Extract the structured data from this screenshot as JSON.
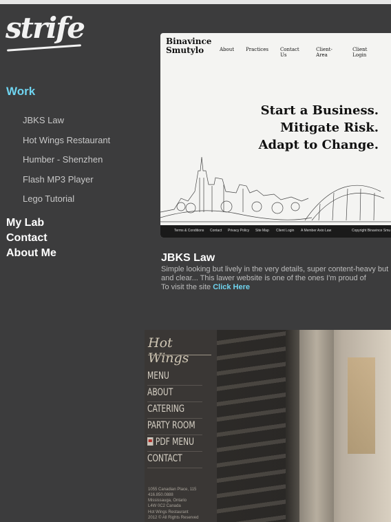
{
  "logo": {
    "text": "strife"
  },
  "sidebar": {
    "work_label": "Work",
    "work_items": [
      "JBKS Law",
      "Hot Wings Restaurant",
      "Humber - Shenzhen",
      "Flash MP3 Player",
      "Lego Tutorial"
    ],
    "main_items": [
      "My Lab",
      "Contact",
      "About Me"
    ]
  },
  "project1": {
    "screenshot": {
      "brand_line1": "Binavince",
      "brand_line2": "Smutylo",
      "nav": [
        "About",
        "Practices",
        "Contact Us",
        "Client-Area",
        "Client Login"
      ],
      "headline": [
        "Start a Business.",
        "Mitigate Risk.",
        "Adapt to Change."
      ],
      "footer": [
        "Terms & Conditions",
        "Contact",
        "Privacy Policy",
        "Site Map",
        "Client Login",
        "A Member Axio Law",
        "Copyright Binavince Smu"
      ]
    },
    "title": "JBKS Law",
    "description": "Simple looking but lively in the very details, super content-heavy but and clear... This lawer website is one of the ones I'm proud of",
    "visit_prefix": "To visit the site",
    "visit_link": "Click Here"
  },
  "project2": {
    "screenshot": {
      "logo": "Hot Wings",
      "menu": [
        "MENU",
        "ABOUT",
        "CATERING",
        "PARTY ROOM",
        "PDF MENU",
        "CONTACT"
      ],
      "address": [
        "1055 Canadian Place, 115",
        "416.850.0888",
        "Mississauga, Ontario",
        "L4W 0C2 Canada"
      ],
      "copyright": [
        "Hot Wings Restaurant",
        "2012 © All Rights Reserved"
      ]
    }
  },
  "colors": {
    "background": "#3c3c3d",
    "accent": "#6fd4f0",
    "sidebar_text": "#c8c8c8"
  }
}
